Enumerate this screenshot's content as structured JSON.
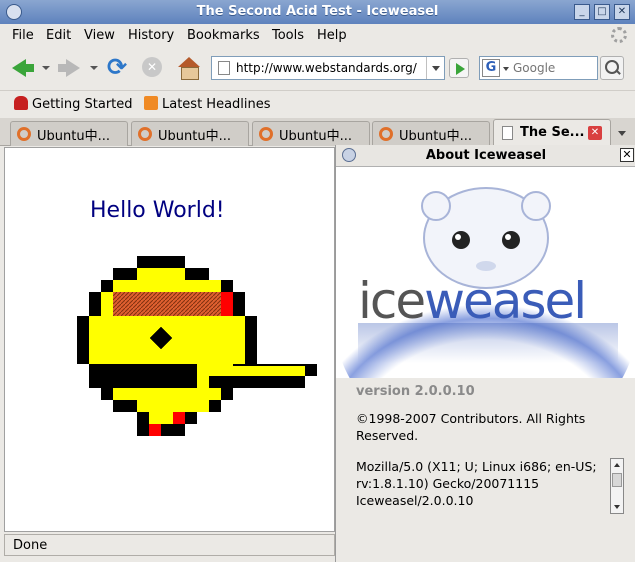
{
  "window": {
    "title": "The Second Acid Test - Iceweasel"
  },
  "menu": {
    "items": [
      {
        "label": "File"
      },
      {
        "label": "Edit"
      },
      {
        "label": "View"
      },
      {
        "label": "History"
      },
      {
        "label": "Bookmarks"
      },
      {
        "label": "Tools"
      },
      {
        "label": "Help"
      }
    ]
  },
  "navbar": {
    "url": "http://www.webstandards.org/",
    "search_placeholder": "Google",
    "search_engine_letter": "G"
  },
  "bookmarks": {
    "items": [
      {
        "label": "Getting Started",
        "icon": "getting-started-icon"
      },
      {
        "label": "Latest Headlines",
        "icon": "rss-icon"
      }
    ]
  },
  "tabs": {
    "items": [
      {
        "label": "Ubuntu中...",
        "active": false
      },
      {
        "label": "Ubuntu中...",
        "active": false
      },
      {
        "label": "Ubuntu中...",
        "active": false
      },
      {
        "label": "Ubuntu中...",
        "active": false
      },
      {
        "label": "The Se...",
        "active": true
      }
    ]
  },
  "page": {
    "heading": "Hello World!",
    "status": "Done"
  },
  "about": {
    "title": "About Iceweasel",
    "logo_text_1": "ice",
    "logo_text_2": "weasel",
    "version": "version 2.0.0.10",
    "copyright": "©1998-2007 Contributors. All Rights Reserved.",
    "user_agent": "Mozilla/5.0 (X11; U; Linux i686; en-US; rv:1.8.1.10) Gecko/20071115 Iceweasel/2.0.0.10"
  },
  "colors": {
    "titlebar": "#5e82bd",
    "face_yellow": "#ffff00",
    "face_red": "#ff0000",
    "logo_blue": "#3a5cb8"
  }
}
